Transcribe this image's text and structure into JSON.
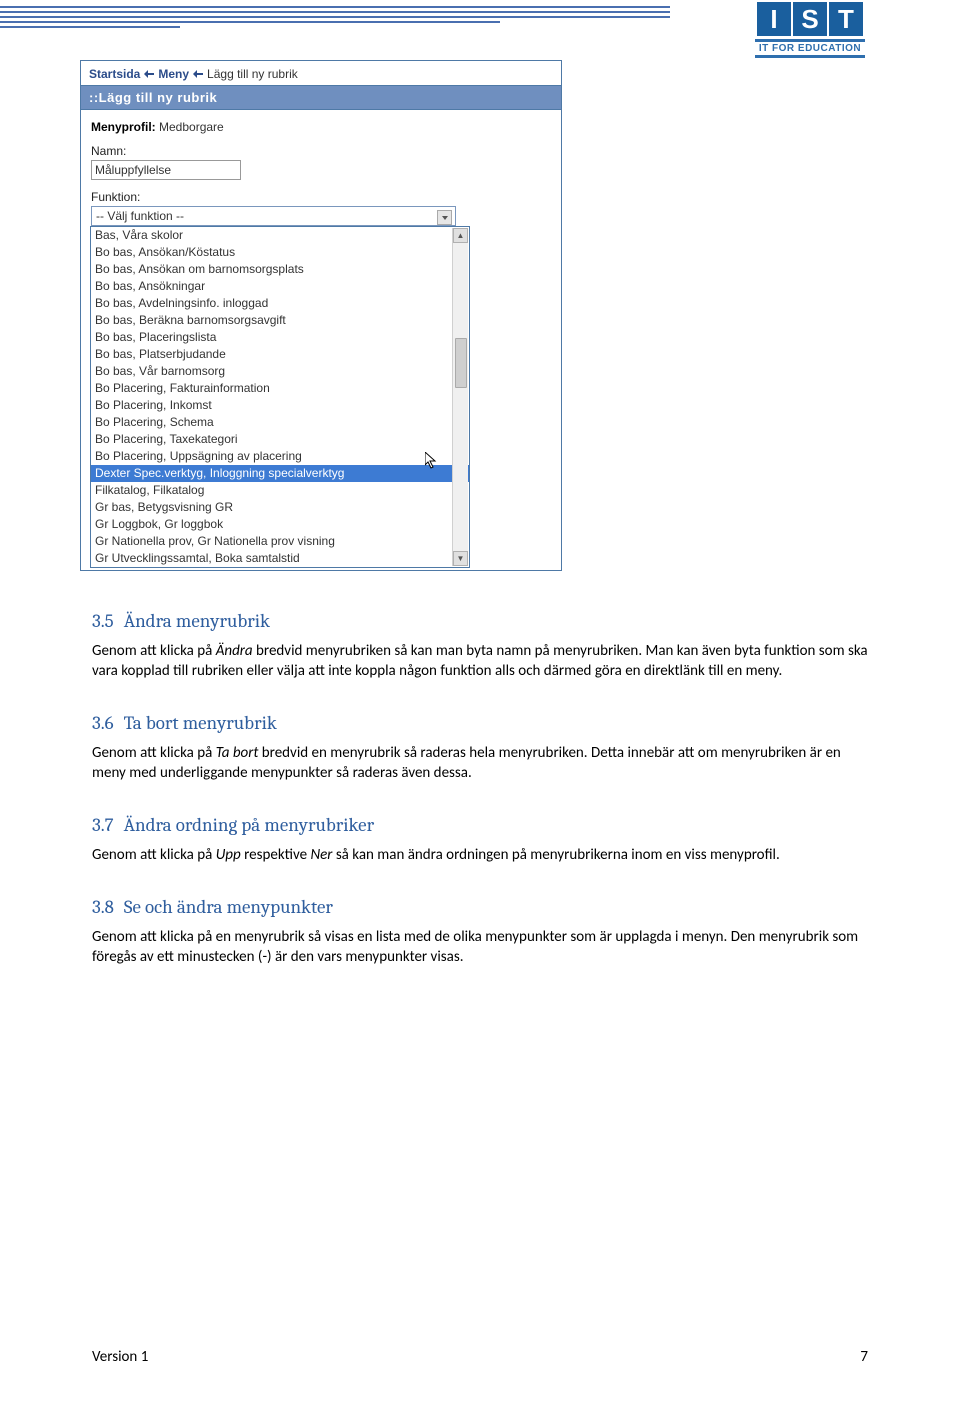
{
  "logo": {
    "letters": [
      "I",
      "S",
      "T"
    ],
    "tagline": "IT FOR EDUCATION"
  },
  "screenshot": {
    "breadcrumbs": [
      "Startsida",
      "Meny",
      "Lägg till ny rubrik"
    ],
    "panel_title": "::Lägg till ny rubrik",
    "menyprofil_label": "Menyprofil:",
    "menyprofil_value": "Medborgare",
    "namn_label": "Namn:",
    "namn_value": "Måluppfyllelse",
    "funktion_label": "Funktion:",
    "funktion_selected": "-- Välj funktion --",
    "options": [
      "Bas, Våra skolor",
      "Bo bas, Ansökan/Köstatus",
      "Bo bas, Ansökan om barnomsorgsplats",
      "Bo bas, Ansökningar",
      "Bo bas, Avdelningsinfo. inloggad",
      "Bo bas, Beräkna barnomsorgsavgift",
      "Bo bas, Placeringslista",
      "Bo bas, Platserbjudande",
      "Bo bas, Vår barnomsorg",
      "Bo Placering, Fakturainformation",
      "Bo Placering, Inkomst",
      "Bo Placering, Schema",
      "Bo Placering, Taxekategori",
      "Bo Placering, Uppsägning av placering",
      "Dexter Spec.verktyg, Inloggning specialverktyg",
      "Filkatalog, Filkatalog",
      "Gr bas, Betygsvisning GR",
      "Gr Loggbok, Gr loggbok",
      "Gr Nationella prov, Gr Nationella prov visning",
      "Gr Utvecklingssamtal, Boka samtalstid"
    ],
    "highlight_index": 14
  },
  "sections": {
    "s35": {
      "num": "3.5",
      "title": "Ändra menyrubrik",
      "p": "Genom att klicka på Ändra bredvid menyrubriken så kan man byta namn på menyrubriken. Man kan även byta funktion som ska vara kopplad till rubriken eller välja att inte koppla någon funktion alls och därmed göra en direktlänk till en meny.",
      "italic": "Ändra"
    },
    "s36": {
      "num": "3.6",
      "title": "Ta bort menyrubrik",
      "p": "Genom att klicka på Ta bort bredvid en menyrubrik så raderas hela menyrubriken. Detta innebär att om menyrubriken är en meny med underliggande menypunkter så raderas även dessa.",
      "italic": "Ta bort"
    },
    "s37": {
      "num": "3.7",
      "title": "Ändra ordning på menyrubriker",
      "p": "Genom att klicka på Upp respektive Ner så kan man ändra ordningen på menyrubrikerna inom en viss menyprofil.",
      "italic1": "Upp",
      "italic2": "Ner"
    },
    "s38": {
      "num": "3.8",
      "title": "Se och ändra menypunkter",
      "p": "Genom att klicka på en menyrubrik så visas en lista med de olika menypunkter som är upplagda i menyn. Den menyrubrik som föregås av ett minustecken (-) är den vars menypunkter visas."
    }
  },
  "footer": {
    "version": "Version 1",
    "page": "7"
  }
}
